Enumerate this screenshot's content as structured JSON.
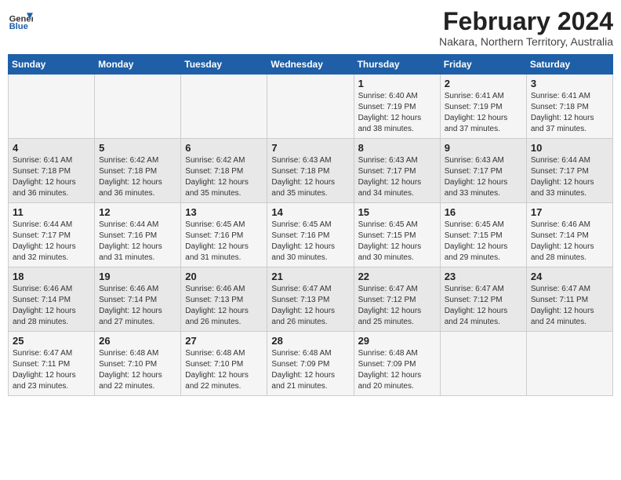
{
  "header": {
    "logo_general": "General",
    "logo_blue": "Blue",
    "month_title": "February 2024",
    "location": "Nakara, Northern Territory, Australia"
  },
  "columns": [
    "Sunday",
    "Monday",
    "Tuesday",
    "Wednesday",
    "Thursday",
    "Friday",
    "Saturday"
  ],
  "weeks": [
    [
      {
        "day": "",
        "info": ""
      },
      {
        "day": "",
        "info": ""
      },
      {
        "day": "",
        "info": ""
      },
      {
        "day": "",
        "info": ""
      },
      {
        "day": "1",
        "info": "Sunrise: 6:40 AM\nSunset: 7:19 PM\nDaylight: 12 hours\nand 38 minutes."
      },
      {
        "day": "2",
        "info": "Sunrise: 6:41 AM\nSunset: 7:19 PM\nDaylight: 12 hours\nand 37 minutes."
      },
      {
        "day": "3",
        "info": "Sunrise: 6:41 AM\nSunset: 7:18 PM\nDaylight: 12 hours\nand 37 minutes."
      }
    ],
    [
      {
        "day": "4",
        "info": "Sunrise: 6:41 AM\nSunset: 7:18 PM\nDaylight: 12 hours\nand 36 minutes."
      },
      {
        "day": "5",
        "info": "Sunrise: 6:42 AM\nSunset: 7:18 PM\nDaylight: 12 hours\nand 36 minutes."
      },
      {
        "day": "6",
        "info": "Sunrise: 6:42 AM\nSunset: 7:18 PM\nDaylight: 12 hours\nand 35 minutes."
      },
      {
        "day": "7",
        "info": "Sunrise: 6:43 AM\nSunset: 7:18 PM\nDaylight: 12 hours\nand 35 minutes."
      },
      {
        "day": "8",
        "info": "Sunrise: 6:43 AM\nSunset: 7:17 PM\nDaylight: 12 hours\nand 34 minutes."
      },
      {
        "day": "9",
        "info": "Sunrise: 6:43 AM\nSunset: 7:17 PM\nDaylight: 12 hours\nand 33 minutes."
      },
      {
        "day": "10",
        "info": "Sunrise: 6:44 AM\nSunset: 7:17 PM\nDaylight: 12 hours\nand 33 minutes."
      }
    ],
    [
      {
        "day": "11",
        "info": "Sunrise: 6:44 AM\nSunset: 7:17 PM\nDaylight: 12 hours\nand 32 minutes."
      },
      {
        "day": "12",
        "info": "Sunrise: 6:44 AM\nSunset: 7:16 PM\nDaylight: 12 hours\nand 31 minutes."
      },
      {
        "day": "13",
        "info": "Sunrise: 6:45 AM\nSunset: 7:16 PM\nDaylight: 12 hours\nand 31 minutes."
      },
      {
        "day": "14",
        "info": "Sunrise: 6:45 AM\nSunset: 7:16 PM\nDaylight: 12 hours\nand 30 minutes."
      },
      {
        "day": "15",
        "info": "Sunrise: 6:45 AM\nSunset: 7:15 PM\nDaylight: 12 hours\nand 30 minutes."
      },
      {
        "day": "16",
        "info": "Sunrise: 6:45 AM\nSunset: 7:15 PM\nDaylight: 12 hours\nand 29 minutes."
      },
      {
        "day": "17",
        "info": "Sunrise: 6:46 AM\nSunset: 7:14 PM\nDaylight: 12 hours\nand 28 minutes."
      }
    ],
    [
      {
        "day": "18",
        "info": "Sunrise: 6:46 AM\nSunset: 7:14 PM\nDaylight: 12 hours\nand 28 minutes."
      },
      {
        "day": "19",
        "info": "Sunrise: 6:46 AM\nSunset: 7:14 PM\nDaylight: 12 hours\nand 27 minutes."
      },
      {
        "day": "20",
        "info": "Sunrise: 6:46 AM\nSunset: 7:13 PM\nDaylight: 12 hours\nand 26 minutes."
      },
      {
        "day": "21",
        "info": "Sunrise: 6:47 AM\nSunset: 7:13 PM\nDaylight: 12 hours\nand 26 minutes."
      },
      {
        "day": "22",
        "info": "Sunrise: 6:47 AM\nSunset: 7:12 PM\nDaylight: 12 hours\nand 25 minutes."
      },
      {
        "day": "23",
        "info": "Sunrise: 6:47 AM\nSunset: 7:12 PM\nDaylight: 12 hours\nand 24 minutes."
      },
      {
        "day": "24",
        "info": "Sunrise: 6:47 AM\nSunset: 7:11 PM\nDaylight: 12 hours\nand 24 minutes."
      }
    ],
    [
      {
        "day": "25",
        "info": "Sunrise: 6:47 AM\nSunset: 7:11 PM\nDaylight: 12 hours\nand 23 minutes."
      },
      {
        "day": "26",
        "info": "Sunrise: 6:48 AM\nSunset: 7:10 PM\nDaylight: 12 hours\nand 22 minutes."
      },
      {
        "day": "27",
        "info": "Sunrise: 6:48 AM\nSunset: 7:10 PM\nDaylight: 12 hours\nand 22 minutes."
      },
      {
        "day": "28",
        "info": "Sunrise: 6:48 AM\nSunset: 7:09 PM\nDaylight: 12 hours\nand 21 minutes."
      },
      {
        "day": "29",
        "info": "Sunrise: 6:48 AM\nSunset: 7:09 PM\nDaylight: 12 hours\nand 20 minutes."
      },
      {
        "day": "",
        "info": ""
      },
      {
        "day": "",
        "info": ""
      }
    ]
  ]
}
